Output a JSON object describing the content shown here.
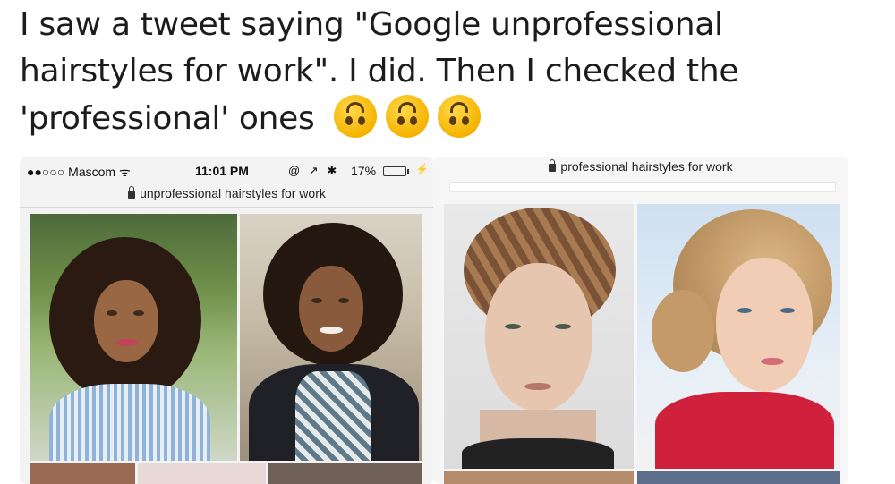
{
  "tweet": {
    "text": "I saw a tweet saying \"Google unprofessional hairstyles for work\". I did. Then I checked the 'professional' ones",
    "emoji_icon": "upside-down-face-emoji",
    "emoji_count": 3
  },
  "left_screenshot": {
    "status_bar": {
      "carrier": "●●○○○ Mascom ᯤ",
      "time": "11:01 PM",
      "icons": "@ ↗ ✱",
      "battery": "17%",
      "battery_level": 0.17
    },
    "url": "unprofessional hairstyles for work"
  },
  "right_screenshot": {
    "url": "professional hairstyles for work"
  },
  "colors": {
    "text": "#1c1c1c",
    "emoji": "#f5b400",
    "battery_low": "#e0a000"
  }
}
